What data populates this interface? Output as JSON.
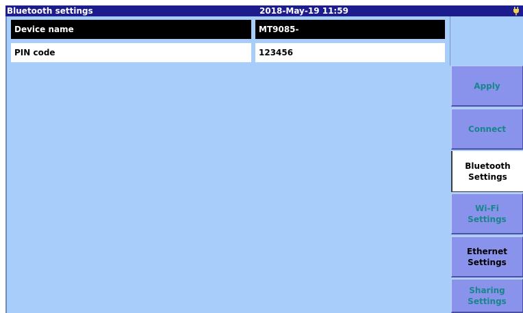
{
  "header": {
    "title": "Bluetooth settings",
    "datetime": "2018-May-19 11:59",
    "icon": "power-plug-icon"
  },
  "fields": [
    {
      "label": "Device name",
      "value": "MT9085-",
      "selected": true
    },
    {
      "label": "PIN code",
      "value": "123456",
      "selected": false
    }
  ],
  "softkeys": [
    {
      "label": "Apply",
      "state": "normal"
    },
    {
      "label": "Connect",
      "state": "normal"
    },
    {
      "label": "Bluetooth\nSettings",
      "state": "active"
    },
    {
      "label": "Wi-Fi\nSettings",
      "state": "normal"
    },
    {
      "label": "Ethernet\nSettings",
      "state": "normal-dark"
    },
    {
      "label": "Sharing\nSettings",
      "state": "normal"
    }
  ],
  "colors": {
    "background": "#a7cdfb",
    "titlebar": "#1c1c8c",
    "softkey": "#8a93ec",
    "softkey_text": "#18858c",
    "selected_row": "#000000"
  }
}
